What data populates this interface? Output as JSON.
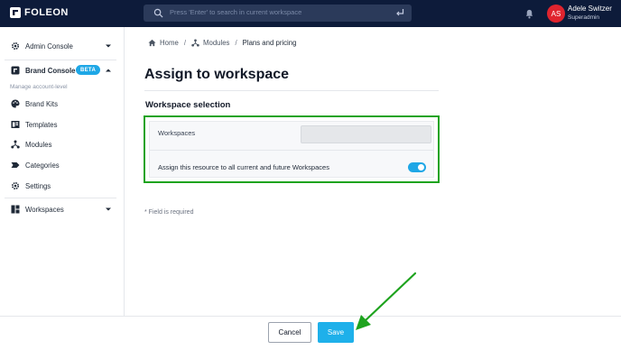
{
  "brand": {
    "name": "FOLEON"
  },
  "search": {
    "placeholder": "Press 'Enter' to search in current workspace"
  },
  "user": {
    "initials": "AS",
    "name": "Adele Switzer",
    "role": "Superadmin"
  },
  "sidebar": {
    "admin_console": "Admin Console",
    "brand_console": "Brand Console",
    "beta_badge": "BETA",
    "sub_label": "Manage account-level",
    "items": [
      {
        "label": "Brand Kits",
        "icon": "palette-icon"
      },
      {
        "label": "Templates",
        "icon": "template-icon"
      },
      {
        "label": "Modules",
        "icon": "modules-icon"
      },
      {
        "label": "Categories",
        "icon": "tag-icon"
      },
      {
        "label": "Settings",
        "icon": "gear-icon"
      }
    ],
    "workspaces": "Workspaces"
  },
  "breadcrumb": {
    "home": "Home",
    "modules": "Modules",
    "current": "Plans and pricing"
  },
  "page": {
    "title": "Assign to workspace",
    "section_title": "Workspace selection",
    "workspaces_label": "Workspaces",
    "assign_label": "Assign this resource to all current and future Workspaces",
    "toggle_on": true,
    "required_note": "* Field is required"
  },
  "footer": {
    "cancel": "Cancel",
    "save": "Save"
  },
  "colors": {
    "topbar": "#0d1b3a",
    "accent": "#1ea7e6",
    "highlight": "#1ea31e",
    "avatar": "#e0242e"
  }
}
